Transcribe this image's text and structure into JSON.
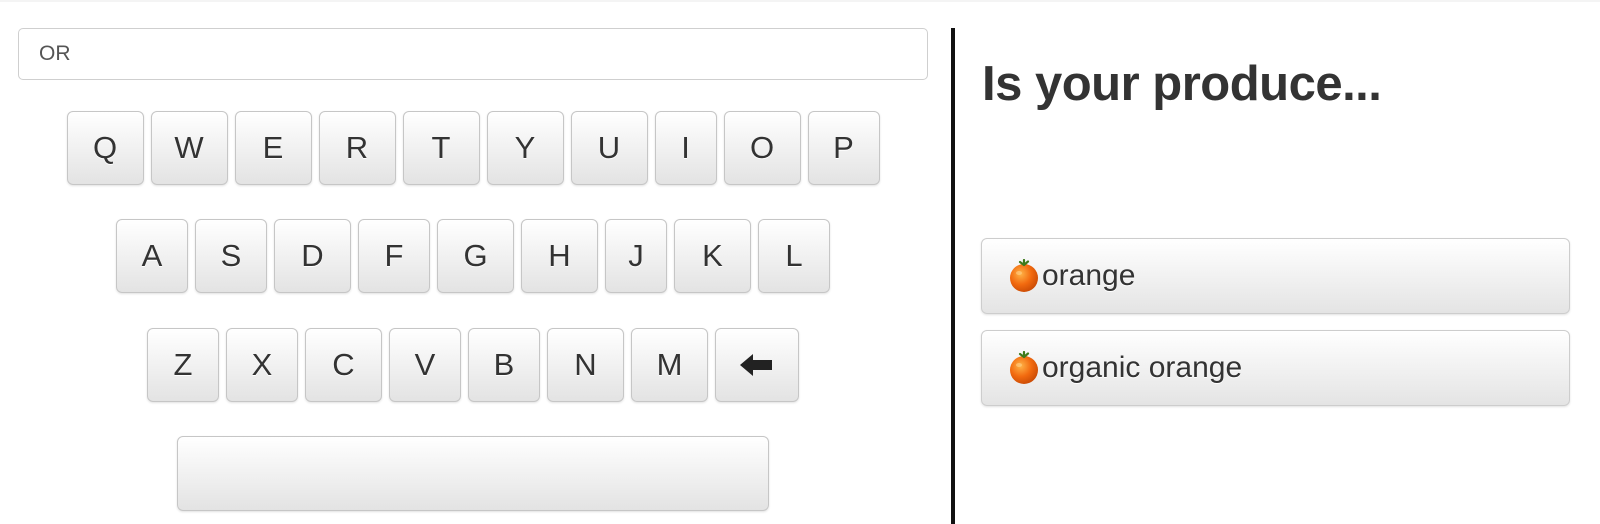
{
  "search": {
    "value": "OR",
    "placeholder": ""
  },
  "keyboard": {
    "row1": [
      "Q",
      "W",
      "E",
      "R",
      "T",
      "Y",
      "U",
      "I",
      "O",
      "P"
    ],
    "row2": [
      "A",
      "S",
      "D",
      "F",
      "G",
      "H",
      "J",
      "K",
      "L"
    ],
    "row3": [
      "Z",
      "X",
      "C",
      "V",
      "B",
      "N",
      "M"
    ],
    "backspace_icon": "left-arrow-icon",
    "space_label": ""
  },
  "results": {
    "heading": "Is your produce...",
    "items": [
      {
        "label": "orange",
        "icon": "orange-fruit-icon"
      },
      {
        "label": "organic orange",
        "icon": "orange-fruit-icon"
      }
    ]
  },
  "colors": {
    "divider": "#111111",
    "key_gradient_top": "#ffffff",
    "key_gradient_bottom": "#e3e3e3",
    "orange": "#f26a0f"
  }
}
